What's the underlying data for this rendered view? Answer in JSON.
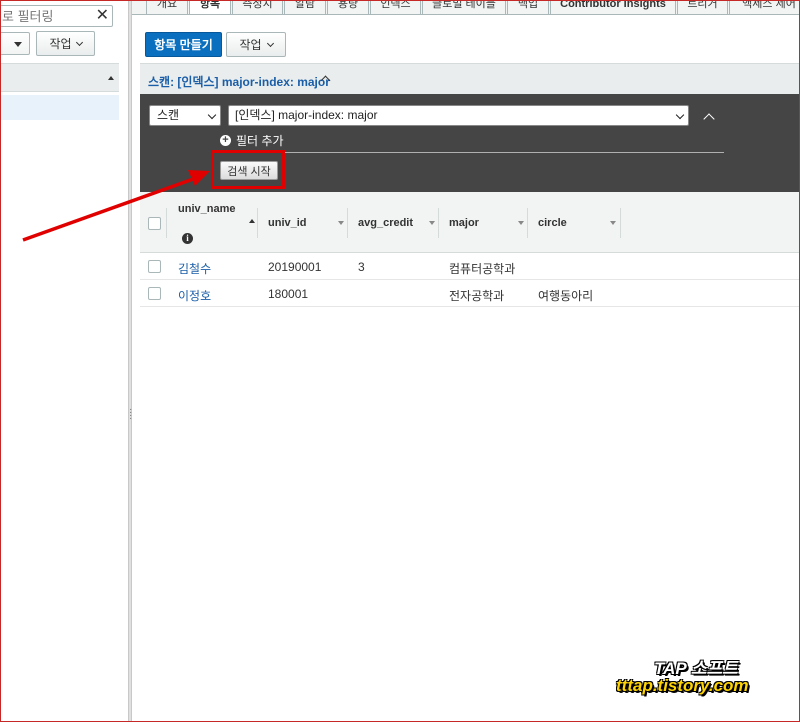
{
  "sidebar": {
    "filter_placeholder": "로 필터링",
    "action_label": "작업"
  },
  "tabs": [
    {
      "label": "개요"
    },
    {
      "label": "항목"
    },
    {
      "label": "측정치"
    },
    {
      "label": "알람"
    },
    {
      "label": "용량"
    },
    {
      "label": "인덱스"
    },
    {
      "label": "글로벌 테이블"
    },
    {
      "label": "백업"
    },
    {
      "label": "Contributor Insights"
    },
    {
      "label": "트리거"
    },
    {
      "label": "액세스 제어"
    }
  ],
  "toolbar": {
    "create_label": "항목 만들기",
    "action_label": "작업"
  },
  "scan": {
    "header_title": "스캔: [인덱스] major-index: major",
    "mode_value": "스캔",
    "index_value": "[인덱스] major-index: major",
    "add_filter_label": "필터 추가",
    "search_button_label": "검색 시작"
  },
  "table": {
    "columns": [
      {
        "label": "univ_name"
      },
      {
        "label": "univ_id"
      },
      {
        "label": "avg_credit"
      },
      {
        "label": "major"
      },
      {
        "label": "circle"
      }
    ],
    "rows": [
      {
        "univ_name": "김철수",
        "univ_id": "20190001",
        "avg_credit": "3",
        "major": "컴퓨터공학과",
        "circle": ""
      },
      {
        "univ_name": "이정호",
        "univ_id": "180001",
        "avg_credit": "",
        "major": "전자공학과",
        "circle": "여행동아리"
      }
    ]
  },
  "watermark": {
    "line1": "TAP 소프트",
    "line2": "tttap.tistory.com"
  },
  "colors": {
    "primary_button": "#0a6fbe",
    "link": "#1a5ea8",
    "scan_panel": "#454545",
    "annotation_red": "#e00000",
    "watermark_yellow": "#ffd400"
  }
}
